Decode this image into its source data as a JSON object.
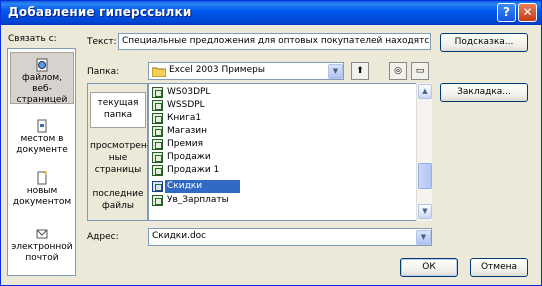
{
  "window": {
    "title": "Добавление гиперссылки"
  },
  "link_to": {
    "label": "Связать с:",
    "items": [
      {
        "label": "файлом, веб-страницей",
        "selected": true
      },
      {
        "label": "местом в документе",
        "selected": false
      },
      {
        "label": "новым документом",
        "selected": false
      },
      {
        "label": "электронной почтой",
        "selected": false
      }
    ]
  },
  "text_field": {
    "label": "Текст:",
    "value": "Специальные предложения для оптовых покупателей находятся зде"
  },
  "hint_button": "Подсказка...",
  "look_in": {
    "label": "Папка:",
    "value": "Excel 2003 Примеры",
    "items": [
      {
        "label": "текущая папка",
        "selected": true
      },
      {
        "label": "просмотрен-ные страницы",
        "selected": false
      },
      {
        "label": "последние файлы",
        "selected": false
      }
    ]
  },
  "bookmark_button": "Закладка...",
  "files": [
    {
      "name": "WS03DPL",
      "selected": false
    },
    {
      "name": "WSSDPL",
      "selected": false
    },
    {
      "name": "Книга1",
      "selected": false
    },
    {
      "name": "Магазин",
      "selected": false
    },
    {
      "name": "Премия",
      "selected": false
    },
    {
      "name": "Продажи",
      "selected": false
    },
    {
      "name": "Продажи 1",
      "selected": false
    },
    {
      "name": "Скидки",
      "selected": true
    },
    {
      "name": "Ув_Зарплаты",
      "selected": false
    }
  ],
  "address": {
    "label": "Адрес:",
    "value": "Скидки.doc"
  },
  "buttons": {
    "ok": "ОК",
    "cancel": "Отмена"
  },
  "colors": {
    "titlebar": "#0054e3",
    "selection": "#316ac5",
    "dialog_bg": "#ece9d8"
  }
}
